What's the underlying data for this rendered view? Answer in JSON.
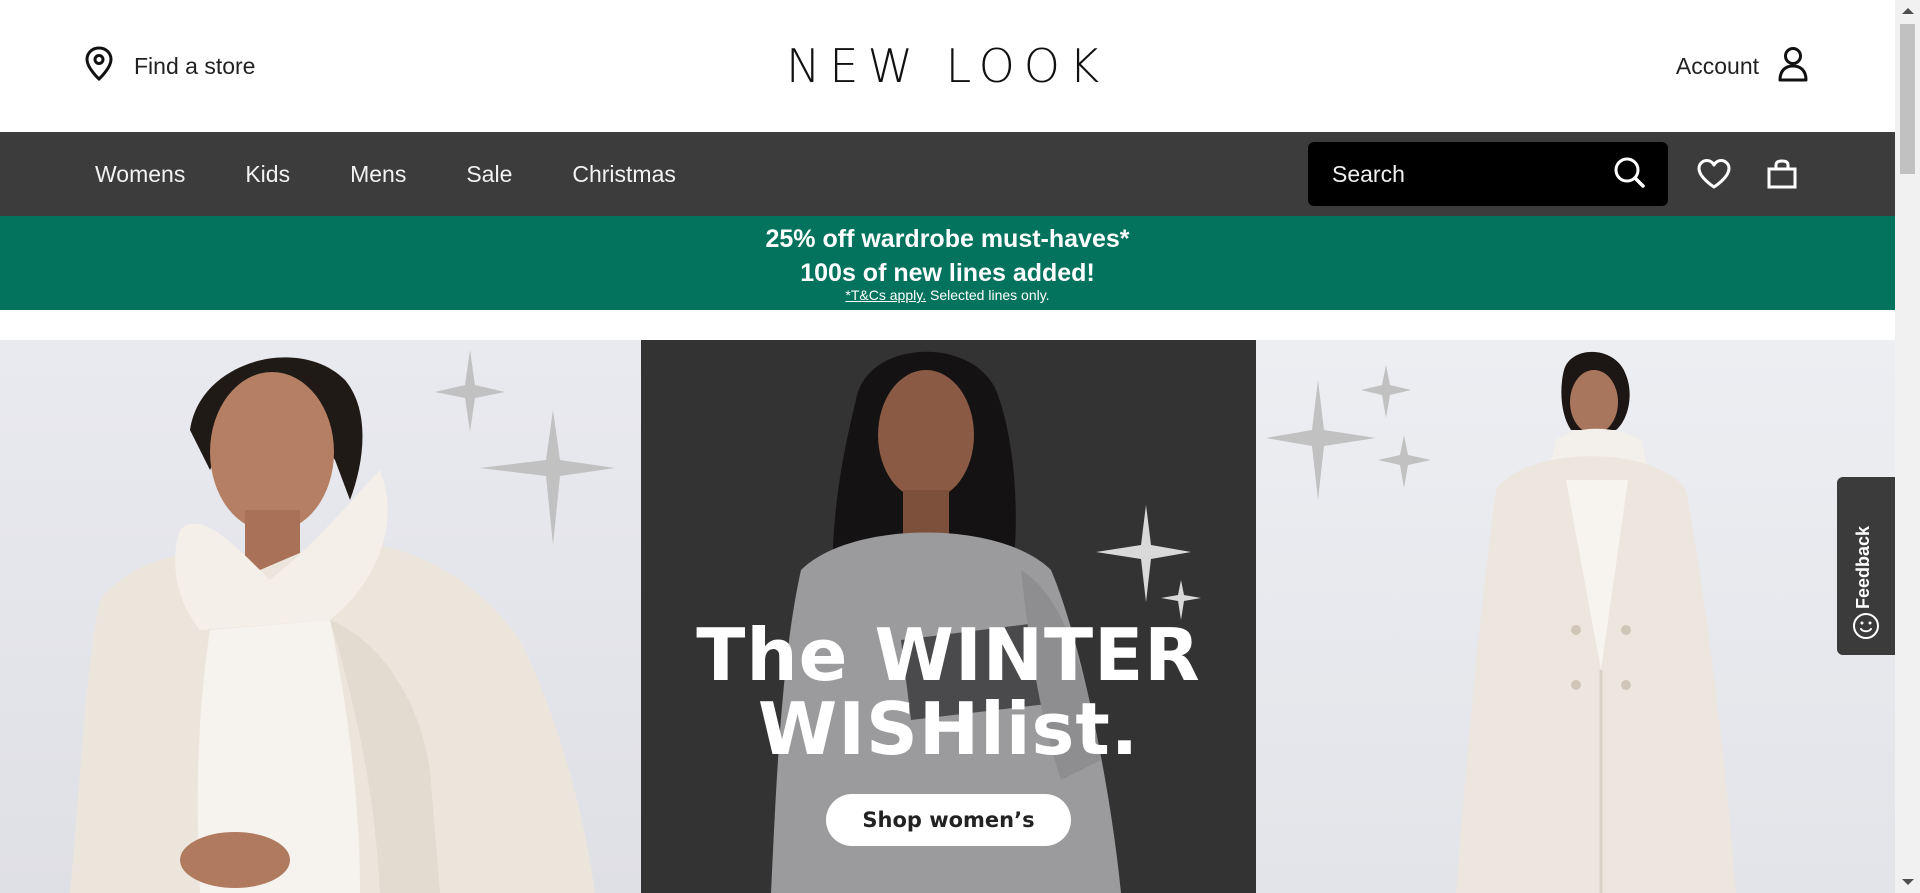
{
  "header": {
    "find_store_label": "Find a store",
    "logo_text": "NEW LOOK",
    "account_label": "Account"
  },
  "nav": {
    "links": [
      "Womens",
      "Kids",
      "Mens",
      "Sale",
      "Christmas"
    ],
    "search_placeholder": "Search"
  },
  "promo": {
    "line1": "25% off wardrobe must-haves*",
    "line2": "100s of new lines added!",
    "terms_link": "*T&Cs apply.",
    "terms_text": " Selected lines only."
  },
  "hero": {
    "title_line1": "The WINTER",
    "title_line2": "WISHlist.",
    "button_label": "Shop women’s"
  },
  "feedback": {
    "label": "Feedback"
  },
  "colors": {
    "nav_bg": "#3c3c3c",
    "promo_bg": "#04735e",
    "search_bg": "#000000",
    "hero_mid_bg": "#343334"
  }
}
